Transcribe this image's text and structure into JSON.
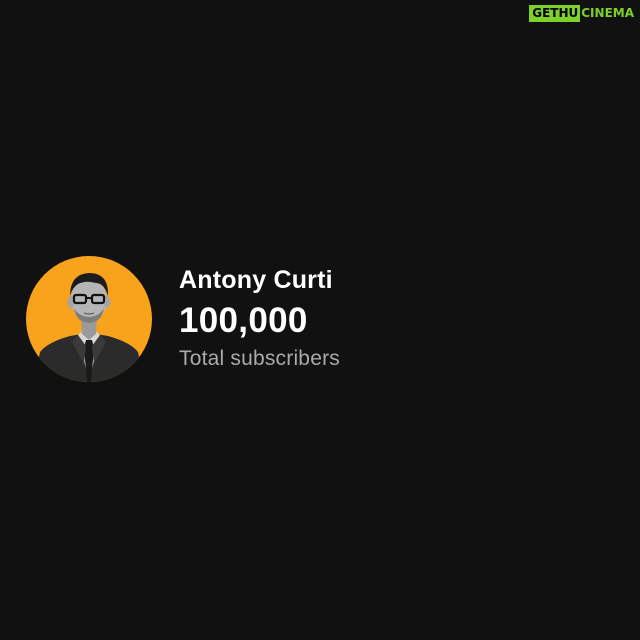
{
  "watermark": {
    "part1": "GETHU",
    "part2": "CINEMA"
  },
  "channel": {
    "name": "Antony Curti",
    "subscriber_count": "100,000",
    "subscriber_label": "Total subscribers",
    "avatar_bg_color": "#f9a21b"
  },
  "colors": {
    "background": "#111111",
    "watermark_green": "#7ed12a",
    "text_primary": "#ffffff",
    "text_secondary": "#aaaaaa"
  }
}
